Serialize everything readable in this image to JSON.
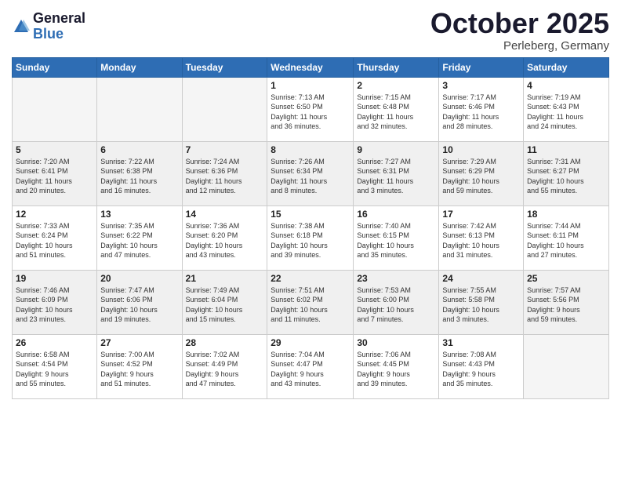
{
  "header": {
    "logo_general": "General",
    "logo_blue": "Blue",
    "month_title": "October 2025",
    "location": "Perleberg, Germany"
  },
  "days_of_week": [
    "Sunday",
    "Monday",
    "Tuesday",
    "Wednesday",
    "Thursday",
    "Friday",
    "Saturday"
  ],
  "weeks": [
    [
      {
        "day": "",
        "info": ""
      },
      {
        "day": "",
        "info": ""
      },
      {
        "day": "",
        "info": ""
      },
      {
        "day": "1",
        "info": "Sunrise: 7:13 AM\nSunset: 6:50 PM\nDaylight: 11 hours\nand 36 minutes."
      },
      {
        "day": "2",
        "info": "Sunrise: 7:15 AM\nSunset: 6:48 PM\nDaylight: 11 hours\nand 32 minutes."
      },
      {
        "day": "3",
        "info": "Sunrise: 7:17 AM\nSunset: 6:46 PM\nDaylight: 11 hours\nand 28 minutes."
      },
      {
        "day": "4",
        "info": "Sunrise: 7:19 AM\nSunset: 6:43 PM\nDaylight: 11 hours\nand 24 minutes."
      }
    ],
    [
      {
        "day": "5",
        "info": "Sunrise: 7:20 AM\nSunset: 6:41 PM\nDaylight: 11 hours\nand 20 minutes."
      },
      {
        "day": "6",
        "info": "Sunrise: 7:22 AM\nSunset: 6:38 PM\nDaylight: 11 hours\nand 16 minutes."
      },
      {
        "day": "7",
        "info": "Sunrise: 7:24 AM\nSunset: 6:36 PM\nDaylight: 11 hours\nand 12 minutes."
      },
      {
        "day": "8",
        "info": "Sunrise: 7:26 AM\nSunset: 6:34 PM\nDaylight: 11 hours\nand 8 minutes."
      },
      {
        "day": "9",
        "info": "Sunrise: 7:27 AM\nSunset: 6:31 PM\nDaylight: 11 hours\nand 3 minutes."
      },
      {
        "day": "10",
        "info": "Sunrise: 7:29 AM\nSunset: 6:29 PM\nDaylight: 10 hours\nand 59 minutes."
      },
      {
        "day": "11",
        "info": "Sunrise: 7:31 AM\nSunset: 6:27 PM\nDaylight: 10 hours\nand 55 minutes."
      }
    ],
    [
      {
        "day": "12",
        "info": "Sunrise: 7:33 AM\nSunset: 6:24 PM\nDaylight: 10 hours\nand 51 minutes."
      },
      {
        "day": "13",
        "info": "Sunrise: 7:35 AM\nSunset: 6:22 PM\nDaylight: 10 hours\nand 47 minutes."
      },
      {
        "day": "14",
        "info": "Sunrise: 7:36 AM\nSunset: 6:20 PM\nDaylight: 10 hours\nand 43 minutes."
      },
      {
        "day": "15",
        "info": "Sunrise: 7:38 AM\nSunset: 6:18 PM\nDaylight: 10 hours\nand 39 minutes."
      },
      {
        "day": "16",
        "info": "Sunrise: 7:40 AM\nSunset: 6:15 PM\nDaylight: 10 hours\nand 35 minutes."
      },
      {
        "day": "17",
        "info": "Sunrise: 7:42 AM\nSunset: 6:13 PM\nDaylight: 10 hours\nand 31 minutes."
      },
      {
        "day": "18",
        "info": "Sunrise: 7:44 AM\nSunset: 6:11 PM\nDaylight: 10 hours\nand 27 minutes."
      }
    ],
    [
      {
        "day": "19",
        "info": "Sunrise: 7:46 AM\nSunset: 6:09 PM\nDaylight: 10 hours\nand 23 minutes."
      },
      {
        "day": "20",
        "info": "Sunrise: 7:47 AM\nSunset: 6:06 PM\nDaylight: 10 hours\nand 19 minutes."
      },
      {
        "day": "21",
        "info": "Sunrise: 7:49 AM\nSunset: 6:04 PM\nDaylight: 10 hours\nand 15 minutes."
      },
      {
        "day": "22",
        "info": "Sunrise: 7:51 AM\nSunset: 6:02 PM\nDaylight: 10 hours\nand 11 minutes."
      },
      {
        "day": "23",
        "info": "Sunrise: 7:53 AM\nSunset: 6:00 PM\nDaylight: 10 hours\nand 7 minutes."
      },
      {
        "day": "24",
        "info": "Sunrise: 7:55 AM\nSunset: 5:58 PM\nDaylight: 10 hours\nand 3 minutes."
      },
      {
        "day": "25",
        "info": "Sunrise: 7:57 AM\nSunset: 5:56 PM\nDaylight: 9 hours\nand 59 minutes."
      }
    ],
    [
      {
        "day": "26",
        "info": "Sunrise: 6:58 AM\nSunset: 4:54 PM\nDaylight: 9 hours\nand 55 minutes."
      },
      {
        "day": "27",
        "info": "Sunrise: 7:00 AM\nSunset: 4:52 PM\nDaylight: 9 hours\nand 51 minutes."
      },
      {
        "day": "28",
        "info": "Sunrise: 7:02 AM\nSunset: 4:49 PM\nDaylight: 9 hours\nand 47 minutes."
      },
      {
        "day": "29",
        "info": "Sunrise: 7:04 AM\nSunset: 4:47 PM\nDaylight: 9 hours\nand 43 minutes."
      },
      {
        "day": "30",
        "info": "Sunrise: 7:06 AM\nSunset: 4:45 PM\nDaylight: 9 hours\nand 39 minutes."
      },
      {
        "day": "31",
        "info": "Sunrise: 7:08 AM\nSunset: 4:43 PM\nDaylight: 9 hours\nand 35 minutes."
      },
      {
        "day": "",
        "info": ""
      }
    ]
  ]
}
